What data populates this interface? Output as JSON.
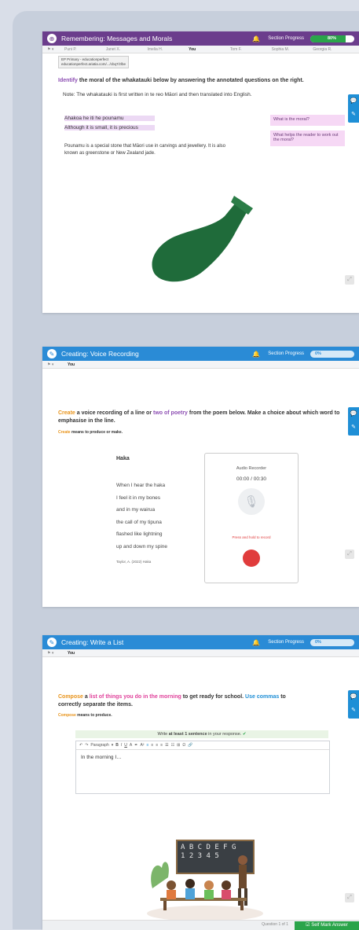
{
  "card1": {
    "title": "Remembering: Messages and Morals",
    "progress_label": "Section Progress",
    "progress_value": "80%",
    "progress_fraction": 0.8,
    "students": [
      "Puni P.",
      "Janet X.",
      "Imelia H.",
      "You",
      "Tom F.",
      "Sophia M.",
      "Georgia R."
    ],
    "tooltip_line1": "EP Primary - educationperfect",
    "tooltip_line2": "educationperfect.ariatia.com/.../cbq7/zlbe",
    "instruction_kw": "Identify",
    "instruction_rest": " the moral of the whakatauki below by answering the annotated questions on the right.",
    "note": "Note: The whakatauki is first written in te reo Māori and then translated into English.",
    "maori_line": "Ahakoa he iti he pounamu",
    "english_line": "Although it is small, it is precious",
    "description": "Pounamu is a special stone that Māori use in carvings and jewellery. It is also known as greenstone or New Zealand jade.",
    "question1": "What is the moral?",
    "question2": "What helps the reader to work out the moral?"
  },
  "card2": {
    "title": "Creating: Voice Recording",
    "progress_label": "Section Progress",
    "progress_value": "0%",
    "progress_fraction": 0.0,
    "you_label": "You",
    "instruction_kw": "Create",
    "instruction_mid": " a voice recording of a line or ",
    "instruction_kw2": "two of poetry",
    "instruction_rest": " from the poem below. Make a choice about which word to emphasise in the line.",
    "definition_kw": "Create",
    "definition_rest": " means to produce or make.",
    "poem_title": "Haka",
    "poem_lines": [
      "When I hear the haka",
      "I feel it in my bones",
      "and in my wairua",
      "the call of my tipuna",
      "flashed like lightning",
      "up and down my spine"
    ],
    "poem_credit": "Taylor, A. (2022) Haka",
    "recorder_title": "Audio Recorder",
    "recorder_time": "00:00 / 00:30",
    "recorder_hint": "Press and hold to record"
  },
  "card3": {
    "title": "Creating: Write a List",
    "progress_label": "Section Progress",
    "progress_value": "0%",
    "progress_fraction": 0.0,
    "you_label": "You",
    "instruction_kw": "Compose",
    "instruction_a": " a ",
    "instruction_kw2": "list of things you do in the morning",
    "instruction_b": " to get ready for school. ",
    "instruction_kw3": "Use commas",
    "instruction_c": " to correctly separate the items.",
    "definition_kw": "Compose",
    "definition_rest": " means to produce.",
    "tip_a": "Write ",
    "tip_b": "at least 1 sentence",
    "tip_c": " in your response.",
    "toolbar_paragraph": "Paragraph",
    "editor_text": "In the morning I…",
    "board_line1": "A B C D E F G",
    "board_line2": "1 2 3 4 5",
    "mark_button": "Self Mark Answer",
    "question_counter": "Question 1 of 1"
  },
  "colors": {
    "purple_bar": "#6b3d8c",
    "blue_bar": "#2a8bd6",
    "accent_orange": "#e8931a",
    "accent_purple": "#8d4fb3",
    "accent_pink": "#e0429b",
    "accent_blue": "#1f8fd6",
    "green": "#2aa44a",
    "pounamu": "#1f6b3a"
  },
  "icons": [
    "ep-logo-icon",
    "bell-icon",
    "flag-icon",
    "speech-icon",
    "pencil-icon",
    "expand-icon",
    "mic-icon",
    "check-icon"
  ]
}
